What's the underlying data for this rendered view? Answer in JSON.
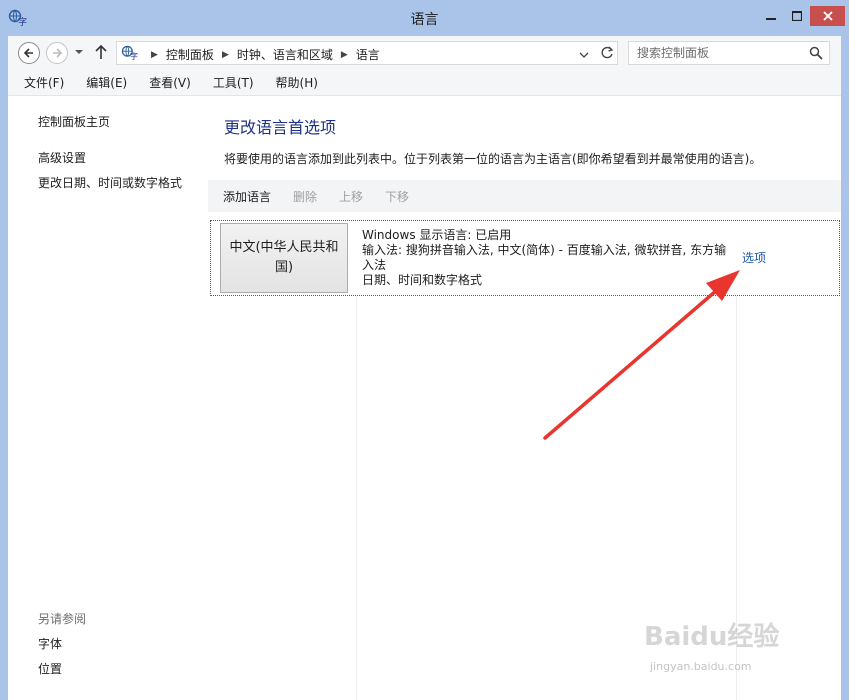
{
  "window": {
    "title": "语言",
    "accent": "#a9c4e8",
    "close_color": "#c7504f"
  },
  "navigation": {
    "breadcrumb": [
      "控制面板",
      "时钟、语言和区域",
      "语言"
    ],
    "search_placeholder": "搜索控制面板"
  },
  "menu": [
    "文件(F)",
    "编辑(E)",
    "查看(V)",
    "工具(T)",
    "帮助(H)"
  ],
  "sidebar": {
    "home": "控制面板主页",
    "links": [
      "高级设置",
      "更改日期、时间或数字格式"
    ],
    "see_also_title": "另请参阅",
    "see_also": [
      "字体",
      "位置"
    ]
  },
  "main": {
    "title": "更改语言首选项",
    "description": "将要使用的语言添加到此列表中。位于列表第一位的语言为主语言(即你希望看到并最常使用的语言)。",
    "toolbar": {
      "add": "添加语言",
      "remove": "删除",
      "move_up": "上移",
      "move_down": "下移"
    },
    "languages": [
      {
        "name": "中文(中华人民共和国)",
        "details": [
          "Windows 显示语言: 已启用",
          "输入法: 搜狗拼音输入法, 中文(简体) - 百度输入法, 微软拼音, 东方输入法",
          "日期、时间和数字格式"
        ],
        "options": "选项"
      }
    ]
  },
  "watermark": {
    "brand": "Baidu经验",
    "url": "jingyan.baidu.com"
  },
  "annotation": {
    "arrow_color": "#e8352e"
  }
}
